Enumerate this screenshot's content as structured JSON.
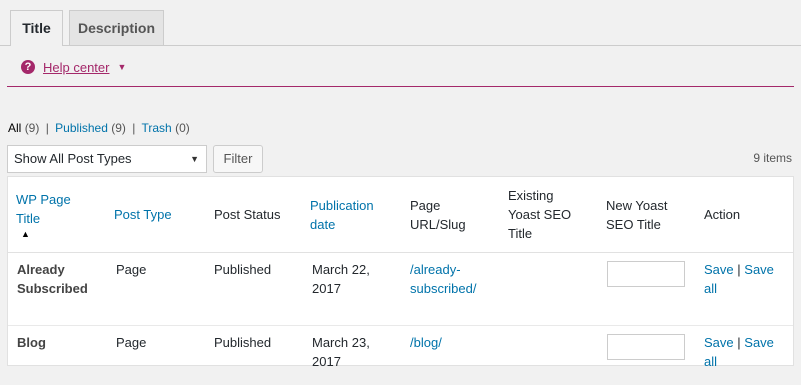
{
  "tabs": [
    {
      "label": "Title",
      "active": true
    },
    {
      "label": "Description",
      "active": false
    }
  ],
  "help": {
    "icon": "?",
    "label": "Help center",
    "caret": "▼"
  },
  "filters": {
    "all": {
      "label": "All",
      "count": "(9)"
    },
    "published": {
      "label": "Published",
      "count": "(9)"
    },
    "trash": {
      "label": "Trash",
      "count": "(0)"
    },
    "separator": "|"
  },
  "post_type_select": {
    "value": "Show All Post Types",
    "caret": "▼"
  },
  "filter_button": "Filter",
  "items_count": "9 items",
  "table": {
    "columns": {
      "title": {
        "line1": "WP Page",
        "line2": "Title",
        "sort_indicator": "▲"
      },
      "post_type": "Post Type",
      "post_status": "Post Status",
      "publication_date": {
        "line1": "Publication",
        "line2": "date"
      },
      "slug": {
        "line1": "Page",
        "line2": "URL/Slug"
      },
      "existing_title": {
        "line1": "Existing",
        "line2": "Yoast SEO",
        "line3": "Title"
      },
      "new_title": {
        "line1": "New Yoast",
        "line2": "SEO Title"
      },
      "action": "Action"
    },
    "rows": [
      {
        "title_line1": "Already",
        "title_line2": "Subscribed",
        "post_type": "Page",
        "post_status": "Published",
        "date_line1": "March 22,",
        "date_line2": "2017",
        "slug_line1": "/already-",
        "slug_line2": "subscribed/",
        "existing_title": "",
        "new_title_value": "",
        "save": "Save",
        "sep": "|",
        "save_all_line1": "Save",
        "save_all_line2": "all"
      },
      {
        "title_line1": "Blog",
        "title_line2": "",
        "post_type": "Page",
        "post_status": "Published",
        "date_line1": "March 23,",
        "date_line2": "2017",
        "slug_line1": "/blog/",
        "slug_line2": "",
        "existing_title": "",
        "new_title_value": "",
        "save": "Save",
        "sep": "|",
        "save_all_line1": "Save",
        "save_all_line2": "all"
      }
    ]
  },
  "colors": {
    "brand": "#a4286a",
    "link": "#0073aa",
    "background": "#f1f1f1"
  }
}
